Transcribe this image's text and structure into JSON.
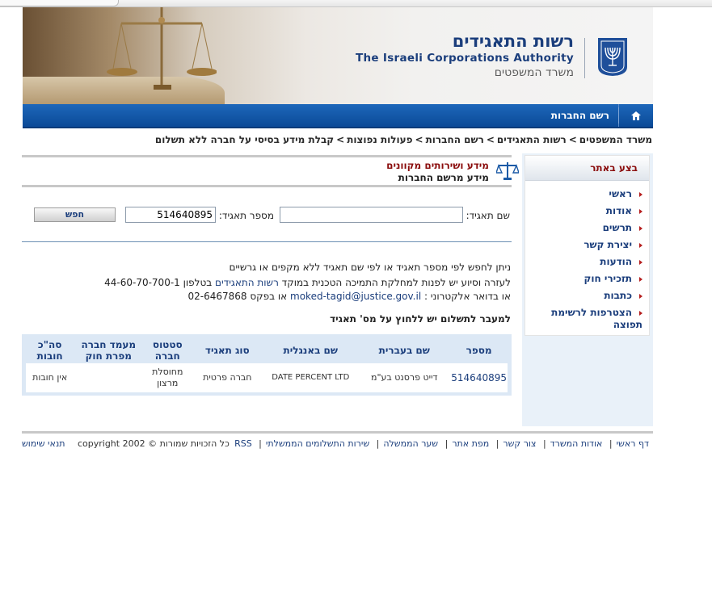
{
  "header": {
    "title_he": "רשות התאגידים",
    "title_en": "The Israeli Corporations Authority",
    "ministry": "משרד המשפטים"
  },
  "nav": {
    "registry": "רשם החברות"
  },
  "breadcrumb": [
    "משרד המשפטים",
    "רשות התאגידים",
    "רשם החברות",
    "פעולות נפוצות",
    "קבלת מידע בסיסי על חברה ללא תשלום"
  ],
  "sidebar": {
    "title": "בצע באתר",
    "items": [
      "ראשי",
      "אודות",
      "תרשים",
      "יצירת קשר",
      "הודעות",
      "תזכירי חוק",
      "כתבות",
      "הצטרפות לרשימת תפוצה"
    ]
  },
  "section": {
    "title": "מידע ושירותים מקוונים",
    "subtitle": "מידע מרשם החברות"
  },
  "search": {
    "name_label": "שם תאגיד:",
    "name_value": "",
    "number_label": "מספר תאגיד:",
    "number_value": "514640895",
    "button": "חפש"
  },
  "info": {
    "line1": "ניתן לחפש לפי מספר תאגיד או לפי שם תאגיד ללא מקפים או גרשיים",
    "line2_pre": "לעזרה וסיוע יש לפנות למחלקת התמיכה הטכנית במוקד",
    "line2_link": "רשות התאגידים",
    "line2_post": "בטלפון 44-60-70-700-1",
    "line3_pre": "או בדואר אלקטרוני :",
    "line3_email": "moked-tagid@justice.gov.il",
    "line3_post": "או בפקס 02-6467868",
    "payment_note": "למעבר לתשלום יש ללחוץ על מס' תאגיד"
  },
  "results": {
    "headers": [
      "מספר",
      "שם בעברית",
      "שם באנגלית",
      "סוג תאגיד",
      "סטטוס חברה",
      "מעמד חברה מפרת חוק",
      "סה\"כ חובות"
    ],
    "rows": [
      [
        "514640895",
        "דייט פרסנט בע\"מ",
        "DATE PERCENT LTD",
        "חברה פרטית",
        "מחוסלת מרצון",
        "",
        "אין חובות"
      ]
    ]
  },
  "footer": {
    "links": [
      "דף ראשי",
      "אודות המשרד",
      "צור קשר",
      "מפת אתר",
      "שער הממשלה",
      "שירות התשלומים הממשלתי",
      "RSS"
    ],
    "rights": "כל הזכויות שמורות © copyright 2002",
    "terms": "תנאי שימוש"
  },
  "colors": {
    "nav_blue": "#0b4a97",
    "title_blue": "#1b3e7c",
    "accent_red": "#8a0c0c"
  }
}
